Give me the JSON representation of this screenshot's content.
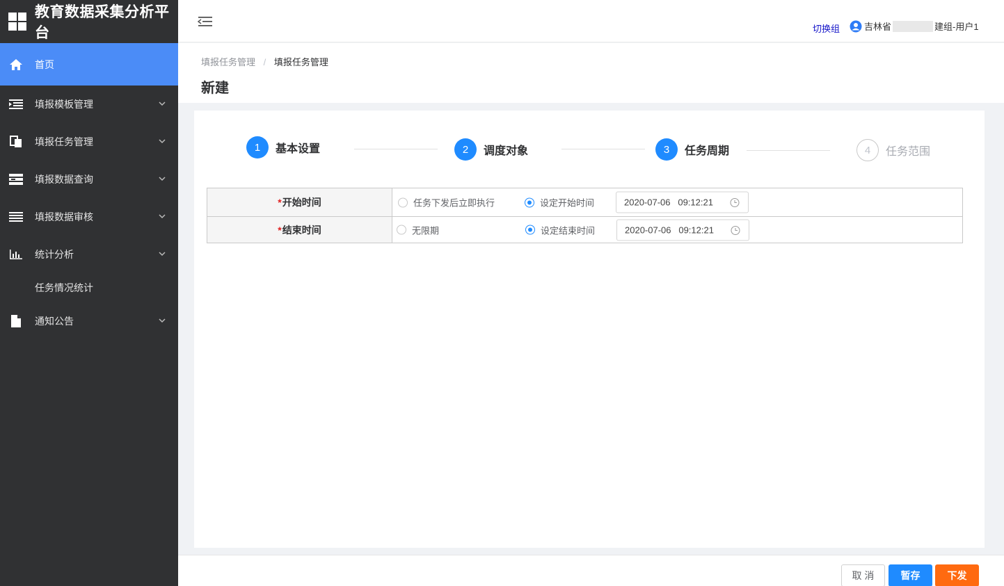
{
  "app": {
    "title": "教育数据采集分析平台"
  },
  "sidebar": {
    "items": [
      {
        "label": "首页",
        "icon": "home-icon",
        "active": true
      },
      {
        "label": "填报模板管理",
        "icon": "template-icon"
      },
      {
        "label": "填报任务管理",
        "icon": "task-icon"
      },
      {
        "label": "填报数据查询",
        "icon": "query-icon"
      },
      {
        "label": "填报数据审核",
        "icon": "audit-icon"
      },
      {
        "label": "统计分析",
        "icon": "chart-icon"
      },
      {
        "label": "任务情况统计",
        "sub": true
      },
      {
        "label": "通知公告",
        "icon": "notice-icon"
      }
    ]
  },
  "header": {
    "switch_group": "切换组",
    "user_prefix": "吉林省",
    "user_suffix": "建组-用户1"
  },
  "breadcrumb": {
    "parent": "填报任务管理",
    "separator": "/",
    "current": "填报任务管理"
  },
  "page": {
    "title": "新建"
  },
  "steps": [
    {
      "num": "1",
      "label": "基本设置",
      "status": "done"
    },
    {
      "num": "2",
      "label": "调度对象",
      "status": "done"
    },
    {
      "num": "3",
      "label": "任务周期",
      "status": "active"
    },
    {
      "num": "4",
      "label": "任务范围",
      "status": "wait"
    }
  ],
  "form": {
    "start": {
      "label": "开始时间",
      "required_mark": "*",
      "opt1": "任务下发后立即执行",
      "opt2": "设定开始时间",
      "value": "2020-07-06   09:12:21"
    },
    "end": {
      "label": "结束时间",
      "required_mark": "*",
      "opt1": "无限期",
      "opt2": "设定结束时间",
      "value": "2020-07-06   09:12:21"
    }
  },
  "footer": {
    "cancel": "取 消",
    "save": "暂存",
    "send": "下发"
  },
  "colors": {
    "primary": "#1f8bff",
    "sidebar_bg": "#303133",
    "active_menu": "#4b8cf7",
    "send_button": "#ff6a10"
  }
}
